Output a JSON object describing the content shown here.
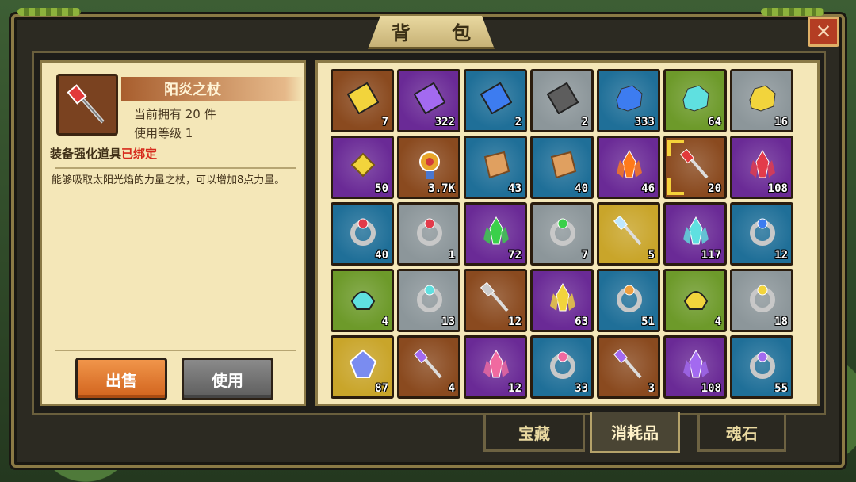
{
  "window": {
    "title": "背 包",
    "close_label": "✕"
  },
  "info_panel": {
    "item_name": "阳炎之杖",
    "owned_label": "当前拥有 20 件",
    "level_label": "使用等级  1",
    "type_label": "装备强化道具",
    "bound_label": "已绑定",
    "description": "能够吸取太阳光焰的力量之杖，可以增加8点力量。",
    "sell_label": "出售",
    "use_label": "使用"
  },
  "tabs": [
    "宝藏",
    "消耗品",
    "魂石"
  ],
  "active_tab": "消耗品",
  "colors": {
    "orange": "#8a4a1f",
    "purple": "#6a2a96",
    "blue": "#1f6f98",
    "gray": "#8c969a",
    "green": "#6d9a2a",
    "gold": "#c9a52a"
  },
  "slots": [
    {
      "bg": "orange",
      "icon": "yellow-gem-card-icon",
      "count": "7"
    },
    {
      "bg": "purple",
      "icon": "purple-book-icon",
      "count": "322"
    },
    {
      "bg": "blue",
      "icon": "blue-book-icon",
      "count": "2"
    },
    {
      "bg": "gray",
      "icon": "gray-book-icon",
      "count": "2"
    },
    {
      "bg": "blue",
      "icon": "blue-ore-icon",
      "count": "333"
    },
    {
      "bg": "green",
      "icon": "cyan-ore-icon",
      "count": "64"
    },
    {
      "bg": "gray",
      "icon": "gold-ore-icon",
      "count": "16"
    },
    {
      "bg": "purple",
      "icon": "golden-rune-icon",
      "count": "50"
    },
    {
      "bg": "orange",
      "icon": "medal-icon",
      "count": "3.7K"
    },
    {
      "bg": "blue",
      "icon": "scroll-icon",
      "count": "43"
    },
    {
      "bg": "blue",
      "icon": "scroll-icon",
      "count": "40"
    },
    {
      "bg": "purple",
      "icon": "fire-crystal-icon",
      "count": "46"
    },
    {
      "bg": "orange",
      "icon": "sun-staff-icon",
      "count": "20",
      "selected": true
    },
    {
      "bg": "purple",
      "icon": "red-crystal-icon",
      "count": "108"
    },
    {
      "bg": "blue",
      "icon": "ruby-ring-icon",
      "count": "40"
    },
    {
      "bg": "gray",
      "icon": "red-ring-icon",
      "count": "1"
    },
    {
      "bg": "purple",
      "icon": "green-crystal-icon",
      "count": "72"
    },
    {
      "bg": "gray",
      "icon": "green-ring-icon",
      "count": "7"
    },
    {
      "bg": "gold",
      "icon": "ice-wand-icon",
      "count": "5"
    },
    {
      "bg": "purple",
      "icon": "cyan-crystal-icon",
      "count": "117"
    },
    {
      "bg": "blue",
      "icon": "sapphire-ring-icon",
      "count": "12"
    },
    {
      "bg": "green",
      "icon": "cyan-helm-icon",
      "count": "4"
    },
    {
      "bg": "gray",
      "icon": "cyan-ring-icon",
      "count": "13"
    },
    {
      "bg": "orange",
      "icon": "staff-icon",
      "count": "12"
    },
    {
      "bg": "purple",
      "icon": "gold-crystal-icon",
      "count": "63"
    },
    {
      "bg": "blue",
      "icon": "amber-ring-icon",
      "count": "51"
    },
    {
      "bg": "green",
      "icon": "gold-helm-icon",
      "count": "4"
    },
    {
      "bg": "gray",
      "icon": "gold-ring-icon",
      "count": "18"
    },
    {
      "bg": "gold",
      "icon": "rainbow-gem-icon",
      "count": "87"
    },
    {
      "bg": "orange",
      "icon": "purple-staff-icon",
      "count": "4"
    },
    {
      "bg": "purple",
      "icon": "pink-crystal-icon",
      "count": "12"
    },
    {
      "bg": "blue",
      "icon": "pink-ring-icon",
      "count": "33"
    },
    {
      "bg": "orange",
      "icon": "purple-staff-icon",
      "count": "3"
    },
    {
      "bg": "purple",
      "icon": "violet-crystal-icon",
      "count": "108"
    },
    {
      "bg": "blue",
      "icon": "amethyst-ring-icon",
      "count": "55"
    }
  ]
}
